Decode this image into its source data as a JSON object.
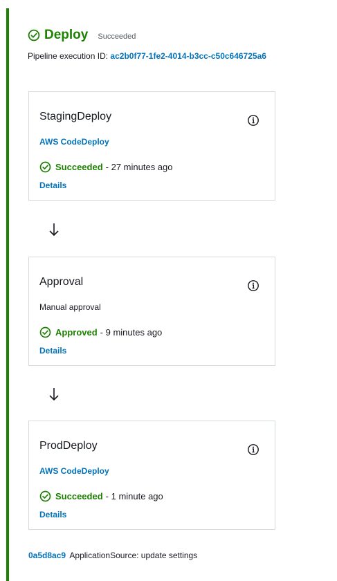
{
  "stage": {
    "name": "Deploy",
    "status": "Succeeded",
    "execution_label": "Pipeline execution ID:",
    "execution_id": "ac2b0f77-1fe2-4014-b3cc-c50c646725a6"
  },
  "actions": [
    {
      "name": "StagingDeploy",
      "provider": "AWS CodeDeploy",
      "status": "Succeeded",
      "time": "- 27 minutes ago",
      "details": "Details"
    },
    {
      "name": "Approval",
      "provider": "Manual approval",
      "status": "Approved",
      "time": "- 9 minutes ago",
      "details": "Details"
    },
    {
      "name": "ProdDeploy",
      "provider": "AWS CodeDeploy",
      "status": "Succeeded",
      "time": "- 1 minute ago",
      "details": "Details"
    }
  ],
  "revision": {
    "id": "0a5d8ac9",
    "message": "ApplicationSource: update settings"
  },
  "colors": {
    "success": "#1d8102",
    "link": "#0073bb",
    "border": "#d5dbdb"
  },
  "icons": [
    "check-circle-icon",
    "info-icon",
    "arrow-down-icon"
  ]
}
